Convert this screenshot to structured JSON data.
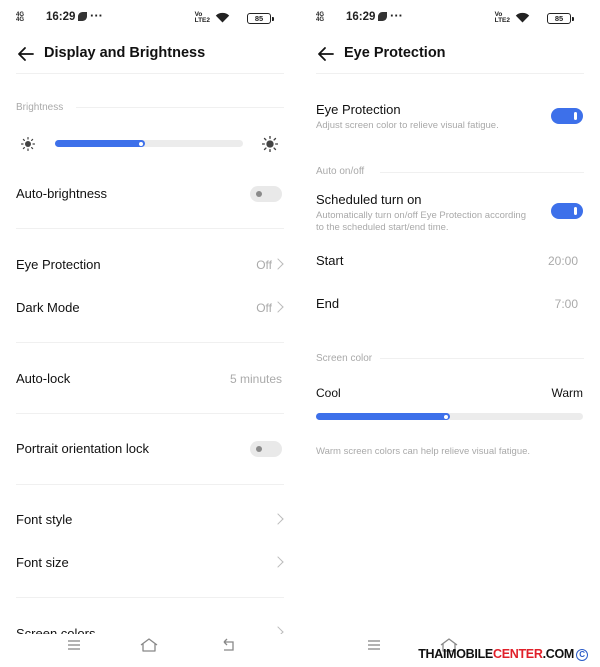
{
  "status": {
    "net": "4G",
    "net2": "4G",
    "time": "16:29",
    "dots": "···",
    "volte_top": "Vo",
    "volte_bottom": "LTE2",
    "battery": "85"
  },
  "left": {
    "title": "Display and Brightness",
    "brightness_label": "Brightness",
    "brightness_level": 0.48,
    "auto_brightness": {
      "label": "Auto-brightness",
      "on": false
    },
    "eye_protection": {
      "label": "Eye Protection",
      "value": "Off"
    },
    "dark_mode": {
      "label": "Dark Mode",
      "value": "Off"
    },
    "auto_lock": {
      "label": "Auto-lock",
      "value": "5 minutes"
    },
    "portrait_lock": {
      "label": "Portrait orientation lock",
      "on": false
    },
    "font_style": {
      "label": "Font style"
    },
    "font_size": {
      "label": "Font size"
    },
    "screen_colors": {
      "label": "Screen colors"
    }
  },
  "right": {
    "title": "Eye Protection",
    "eye_protection": {
      "label": "Eye Protection",
      "desc": "Adjust screen color to relieve visual fatigue.",
      "on": true
    },
    "auto_label": "Auto on/off",
    "scheduled": {
      "label": "Scheduled turn on",
      "desc1": "Automatically turn on/off Eye Protection according",
      "desc2": "to the scheduled start/end time.",
      "on": true
    },
    "start": {
      "label": "Start",
      "value": "20:00"
    },
    "end": {
      "label": "End",
      "value": "7:00"
    },
    "screen_color_label": "Screen color",
    "cool_label": "Cool",
    "warm_label": "Warm",
    "color_level": 0.5,
    "hint": "Warm screen colors can help relieve visual fatigue."
  },
  "watermark": {
    "part1": "THAIMOBILE",
    "part2": "CENTER",
    "part3": ".COM",
    "copy": "C"
  },
  "colors": {
    "accent": "#3d70ea",
    "watermark_red": "#e0202a"
  }
}
